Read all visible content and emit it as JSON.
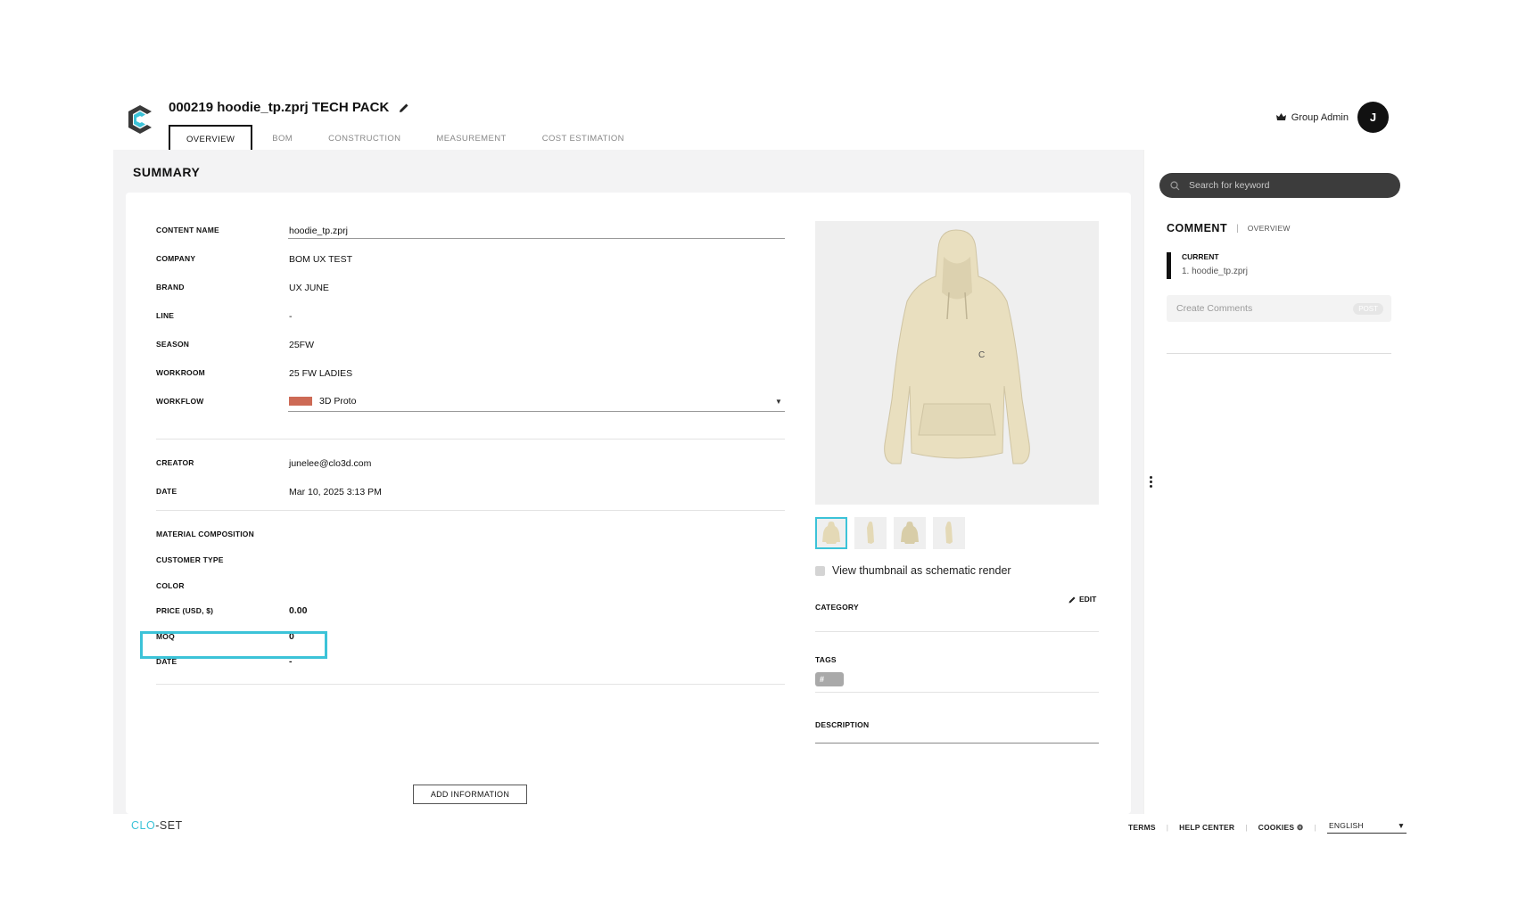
{
  "header": {
    "title": "000219 hoodie_tp.zprj TECH PACK",
    "tabs": [
      "OVERVIEW",
      "BOM",
      "CONSTRUCTION",
      "MEASUREMENT",
      "COST ESTIMATION"
    ],
    "active_tab": "OVERVIEW",
    "user_role": "Group Admin",
    "avatar_initial": "J"
  },
  "summary": {
    "title": "SUMMARY",
    "fields": {
      "content_name": {
        "label": "CONTENT NAME",
        "value": "hoodie_tp.zprj"
      },
      "company": {
        "label": "COMPANY",
        "value": "BOM UX TEST"
      },
      "brand": {
        "label": "BRAND",
        "value": "UX JUNE"
      },
      "line": {
        "label": "LINE",
        "value": "-"
      },
      "season": {
        "label": "SEASON",
        "value": "25FW"
      },
      "workroom": {
        "label": "WORKROOM",
        "value": "25 FW LADIES"
      },
      "workflow": {
        "label": "WORKFLOW",
        "value": "3D Proto",
        "color": "#cd6a55"
      },
      "creator": {
        "label": "CREATOR",
        "value": "junelee@clo3d.com"
      },
      "date": {
        "label": "DATE",
        "value": "Mar 10, 2025 3:13 PM"
      },
      "material": {
        "label": "MATERIAL COMPOSITION",
        "value": ""
      },
      "customer_type": {
        "label": "CUSTOMER TYPE",
        "value": ""
      },
      "color": {
        "label": "COLOR",
        "value": ""
      },
      "price": {
        "label": "PRICE (USD, $)",
        "value": "0.00"
      },
      "moq": {
        "label": "MOQ",
        "value": "0"
      },
      "date2": {
        "label": "DATE",
        "value": "-"
      }
    },
    "add_button": "ADD INFORMATION"
  },
  "preview": {
    "schematic_label": "View thumbnail as schematic render",
    "edit_label": "EDIT",
    "category_label": "CATEGORY",
    "tags_label": "TAGS",
    "tag_value": "#",
    "description_label": "DESCRIPTION"
  },
  "comments": {
    "search_placeholder": "Search for keyword",
    "title": "COMMENT",
    "tab": "OVERVIEW",
    "current_label": "CURRENT",
    "current_file": "1. hoodie_tp.zprj",
    "create_placeholder": "Create Comments",
    "post_label": "POST"
  },
  "footer": {
    "brand_part1": "CLO",
    "brand_part2": "-SET",
    "links": [
      "TERMS",
      "HELP CENTER",
      "COOKIES"
    ],
    "language": "ENGLISH"
  },
  "colors": {
    "accent": "#3cc3d8",
    "workflow_swatch": "#cd6a55",
    "hoodie": "#e9dfbf"
  }
}
